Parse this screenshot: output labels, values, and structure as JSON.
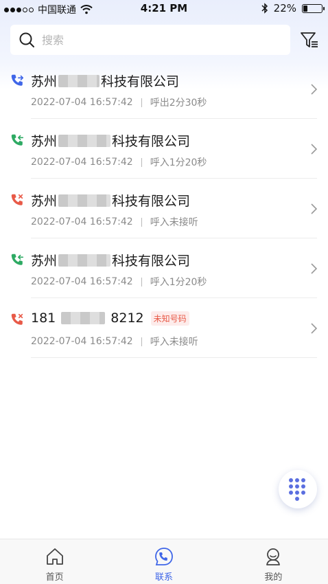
{
  "status_bar": {
    "carrier": "中国联通",
    "time": "4:21 PM",
    "battery_text": "22%",
    "battery_level": 0.22
  },
  "search": {
    "placeholder": "搜索",
    "value": ""
  },
  "colors": {
    "outgoing": "#3f66e8",
    "incoming": "#2eaa63",
    "missed": "#e85a48",
    "accent": "#3f66e8"
  },
  "calls": [
    {
      "name_prefix": "苏州",
      "name_suffix": "科技有限公司",
      "time": "2022-07-04 16:57:42",
      "detail": "呼出2分30秒",
      "type": "outgoing",
      "icon": "outgoing-call-icon"
    },
    {
      "name_prefix": "苏州",
      "name_suffix": "科技有限公司",
      "time": "2022-07-04 16:57:42",
      "detail": "呼入1分20秒",
      "type": "incoming",
      "icon": "incoming-call-icon"
    },
    {
      "name_prefix": "苏州",
      "name_suffix": "科技有限公司",
      "time": "2022-07-04 16:57:42",
      "detail": "呼入未接听",
      "type": "missed",
      "icon": "missed-call-icon"
    },
    {
      "name_prefix": "苏州",
      "name_suffix": "科技有限公司",
      "time": "2022-07-04 16:57:42",
      "detail": "呼入1分20秒",
      "type": "incoming",
      "icon": "incoming-call-icon"
    },
    {
      "name_prefix": "181",
      "name_suffix": "8212",
      "badge": "未知号码",
      "time": "2022-07-04 16:57:42",
      "detail": "呼入未接听",
      "type": "missed",
      "icon": "missed-call-icon"
    }
  ],
  "tabs": [
    {
      "label": "首页",
      "icon": "home-icon",
      "active": false
    },
    {
      "label": "联系",
      "icon": "contact-icon",
      "active": true
    },
    {
      "label": "我的",
      "icon": "profile-icon",
      "active": false
    }
  ]
}
